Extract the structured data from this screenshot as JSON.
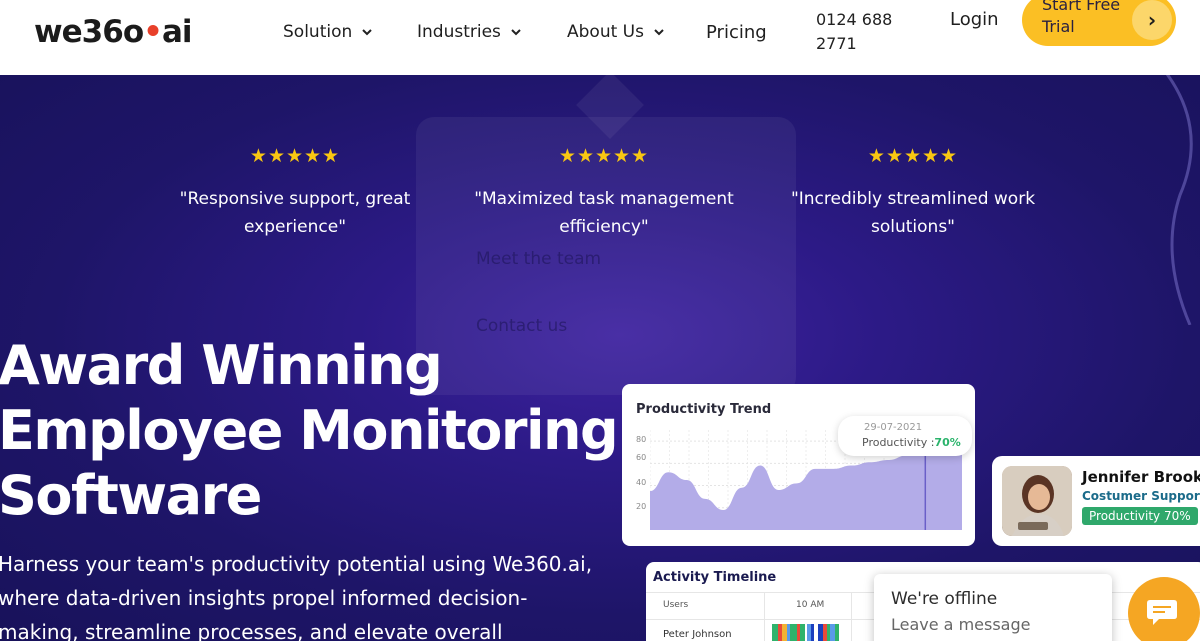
{
  "brand": {
    "logo_text_a": "we36",
    "logo_text_o": "o",
    "logo_text_dot": "•",
    "logo_text_b": "ai"
  },
  "nav": {
    "items": [
      {
        "label": "Solution",
        "has_dropdown": true
      },
      {
        "label": "Industries",
        "has_dropdown": true
      },
      {
        "label": "About Us",
        "has_dropdown": true
      },
      {
        "label": "Pricing",
        "has_dropdown": false
      }
    ],
    "phone_line1": "0124 688",
    "phone_line2": "2771",
    "login": "Login",
    "cta_line1": "Start Free",
    "cta_line2": "Trial",
    "cta_arrow": "›"
  },
  "dropdown_ghost": {
    "link1": "Meet the team",
    "link2": "Contact us"
  },
  "reviews": [
    {
      "stars": "★★★★★",
      "line1": "\"Responsive support, great",
      "line2": "experience\""
    },
    {
      "stars": "★★★★★",
      "line1": "\"Maximized task management",
      "line2": "efficiency\""
    },
    {
      "stars": "★★★★★",
      "line1": "\"Incredibly streamlined work",
      "line2": "solutions\""
    }
  ],
  "hero": {
    "headline_line1": "Award Winning",
    "headline_line2": "Employee Monitoring",
    "headline_line3": "Software",
    "sub_line1": "Harness your team's productivity potential using We360.ai,",
    "sub_line2": "where data-driven insights propel informed decision-",
    "sub_line3": "making, streamline processes, and elevate overall"
  },
  "productivity_card": {
    "title": "Productivity Trend",
    "y_ticks": [
      "80",
      "60",
      "40",
      "20"
    ],
    "tooltip_date": "29-07-2021",
    "tooltip_label": "Productivity :",
    "tooltip_value": "70%"
  },
  "chart_data": {
    "type": "area",
    "title": "Productivity Trend",
    "xlabel": "",
    "ylabel": "",
    "ylim": [
      0,
      90
    ],
    "y_ticks": [
      20,
      40,
      60,
      80
    ],
    "values": [
      35,
      52,
      45,
      28,
      18,
      38,
      58,
      36,
      42,
      55,
      55,
      58,
      61,
      63,
      67,
      70,
      73,
      68
    ],
    "color": "#b3ace8",
    "grid": true
  },
  "person_card": {
    "name": "Jennifer Brooke",
    "role": "Costumer Support",
    "badge": "Productivity 70%"
  },
  "activity": {
    "title": "Activity Timeline",
    "col_users": "Users",
    "col_time": "10 AM",
    "row_name": "Peter Johnson"
  },
  "chat": {
    "title": "We're offline",
    "subtitle": "Leave a message",
    "icon": "chat-icon",
    "color": "#f5a623"
  },
  "colors": {
    "hero_bg": "#1d1660",
    "cta": "#fbbf24",
    "star": "#f9c712",
    "badge_green": "#2fa86b"
  }
}
